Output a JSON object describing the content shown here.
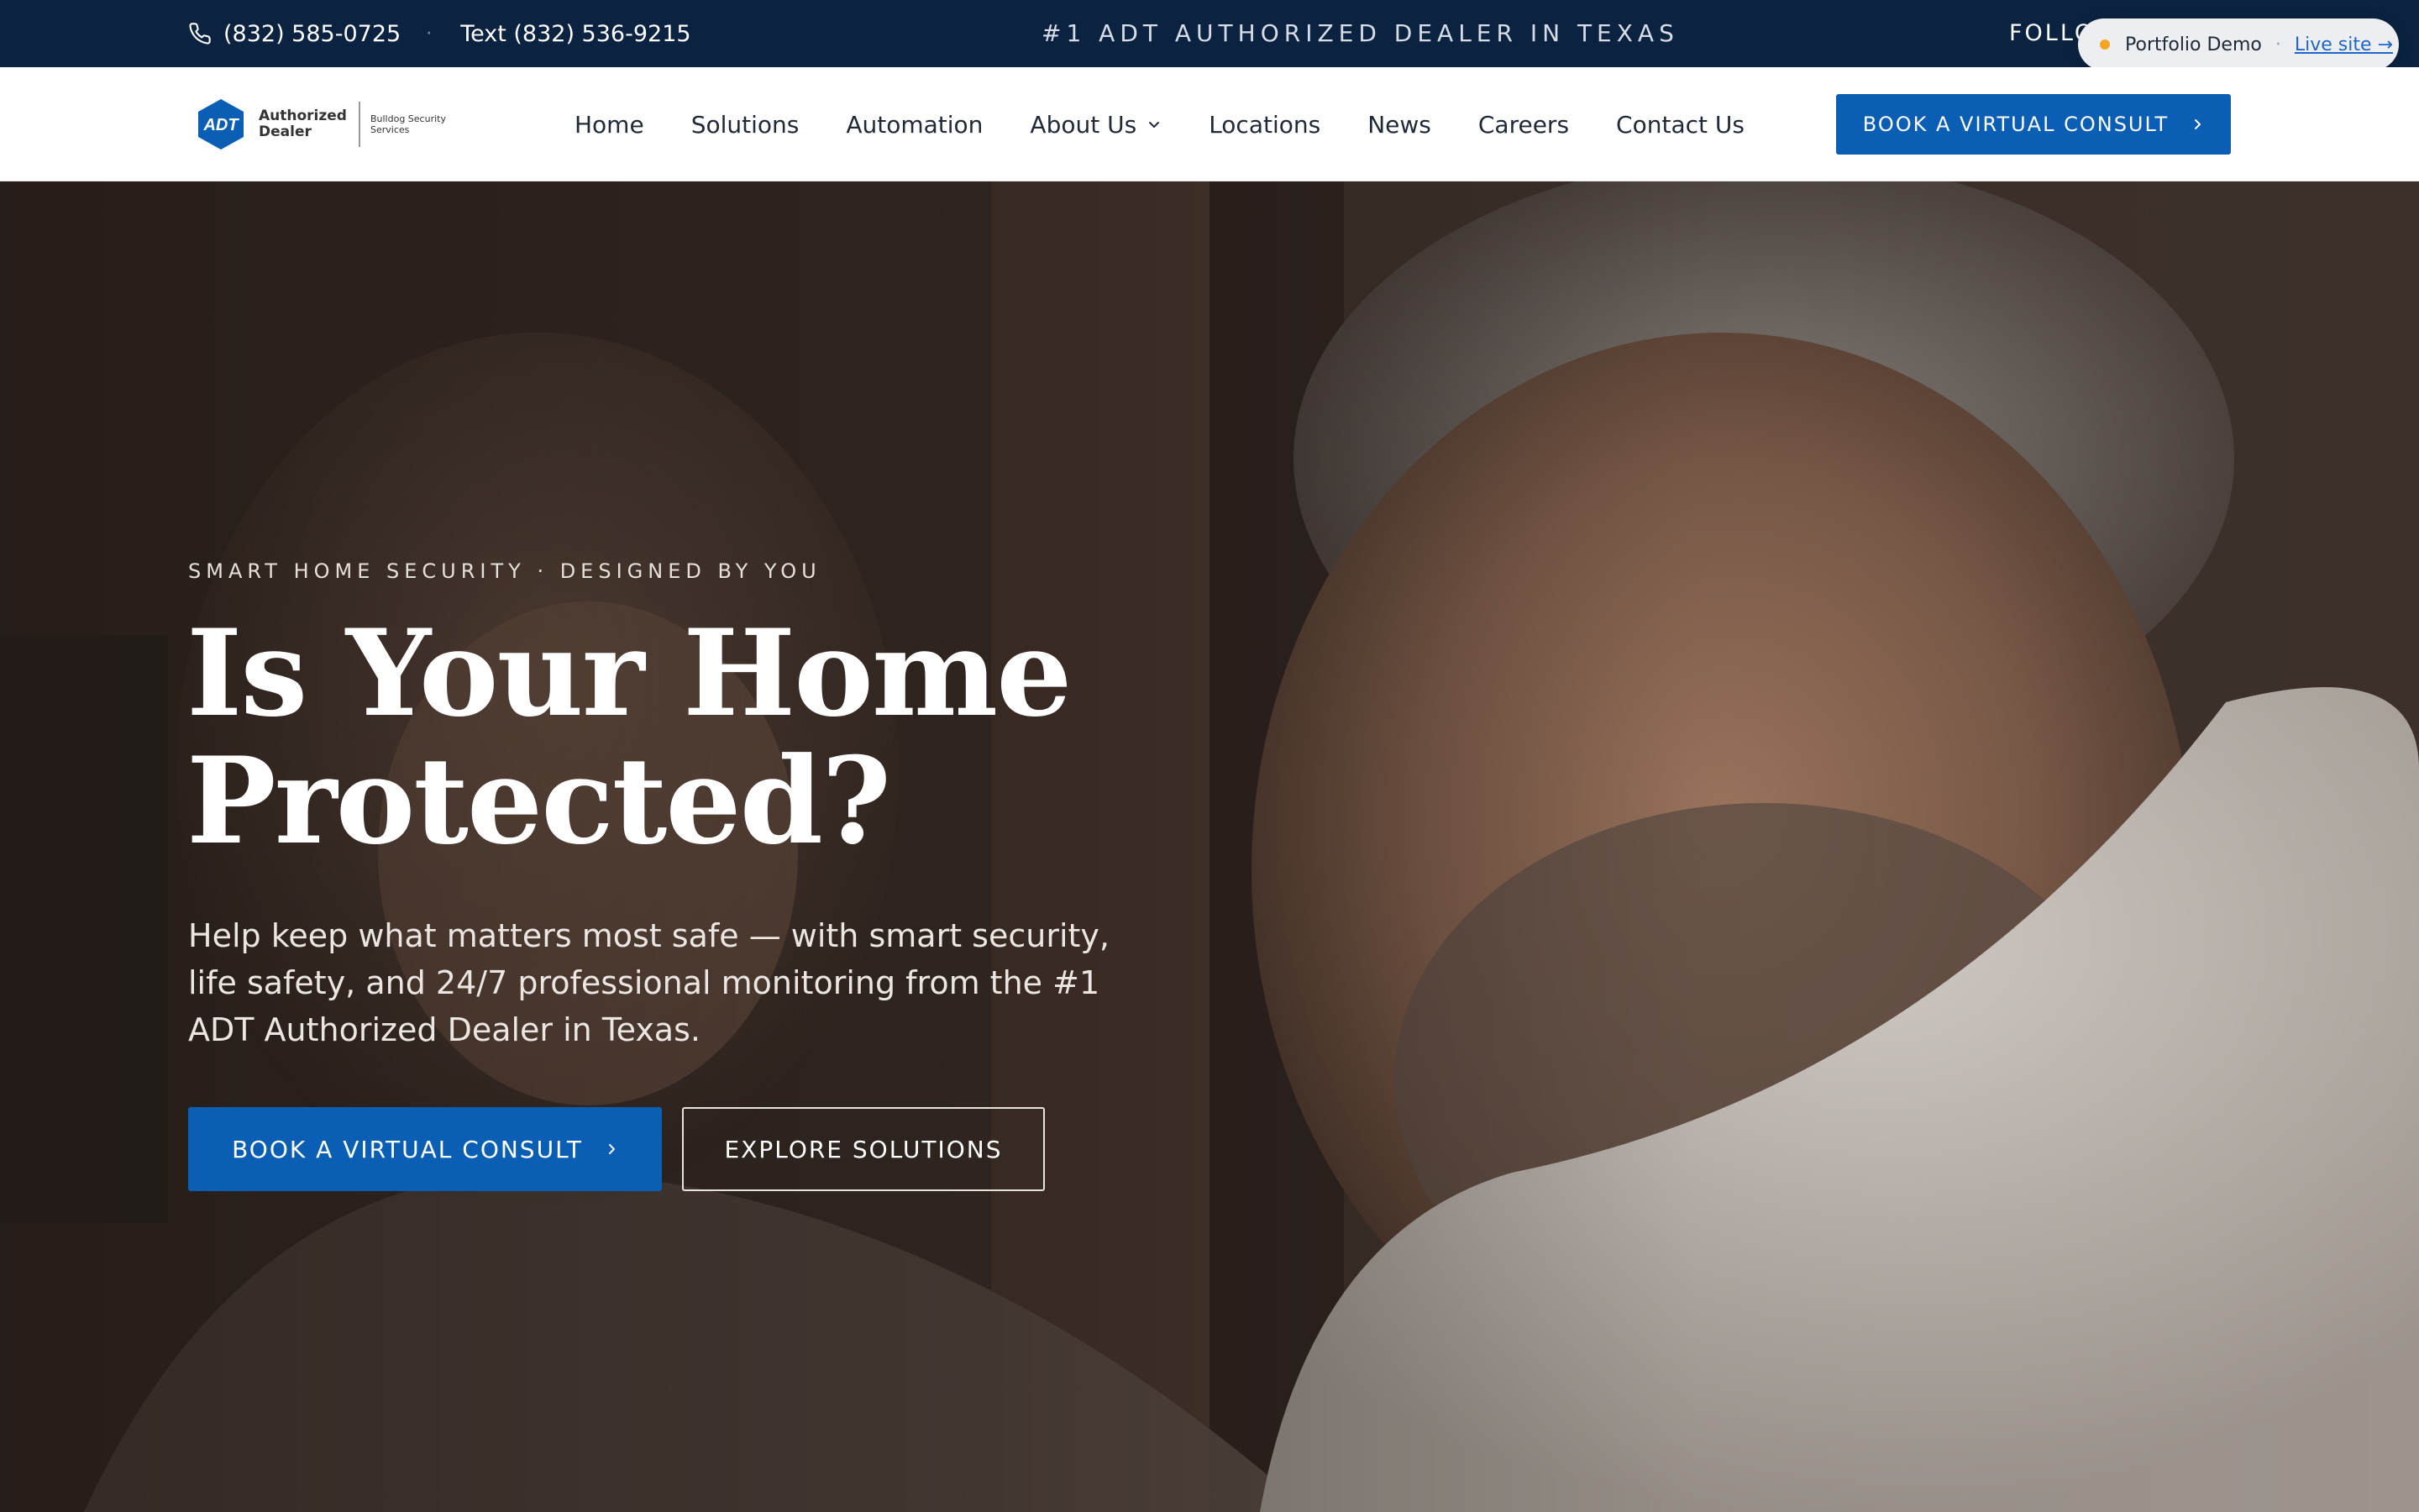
{
  "topbar": {
    "phone": "(832) 585-0725",
    "separator": "·",
    "text_line": "Text (832) 536-9215",
    "tagline": "#1 ADT AUTHORIZED DEALER IN TEXAS",
    "follow": "FOLLO"
  },
  "portfolio_pill": {
    "label": "Portfolio Demo",
    "separator": "·",
    "link": "Live site →"
  },
  "logo": {
    "mark": "ADT",
    "line1": "Authorized",
    "line2": "Dealer",
    "sub1": "Bulldog Security",
    "sub2": "Services"
  },
  "nav": {
    "items": [
      {
        "label": "Home"
      },
      {
        "label": "Solutions"
      },
      {
        "label": "Automation"
      },
      {
        "label": "About Us",
        "has_dropdown": true
      },
      {
        "label": "Locations"
      },
      {
        "label": "News"
      },
      {
        "label": "Careers"
      },
      {
        "label": "Contact Us"
      }
    ],
    "cta": "BOOK A VIRTUAL CONSULT"
  },
  "hero": {
    "eyebrow": "SMART HOME SECURITY · DESIGNED BY YOU",
    "headline_line1": "Is Your Home",
    "headline_line2": "Protected?",
    "lede": "Help keep what matters most safe — with smart security, life safety, and 24/7 professional monitoring from the #1 ADT Authorized Dealer in Texas.",
    "primary_button": "BOOK A VIRTUAL CONSULT",
    "secondary_button": "EXPLORE SOLUTIONS"
  },
  "colors": {
    "topbar_bg": "#0b2340",
    "brand_blue": "#0a5fb4",
    "pill_dot": "#f5a524",
    "link_blue": "#1e66c9"
  },
  "icons": [
    "phone-icon",
    "chevron-down-icon",
    "chevron-right-icon",
    "adt-logo-icon"
  ]
}
